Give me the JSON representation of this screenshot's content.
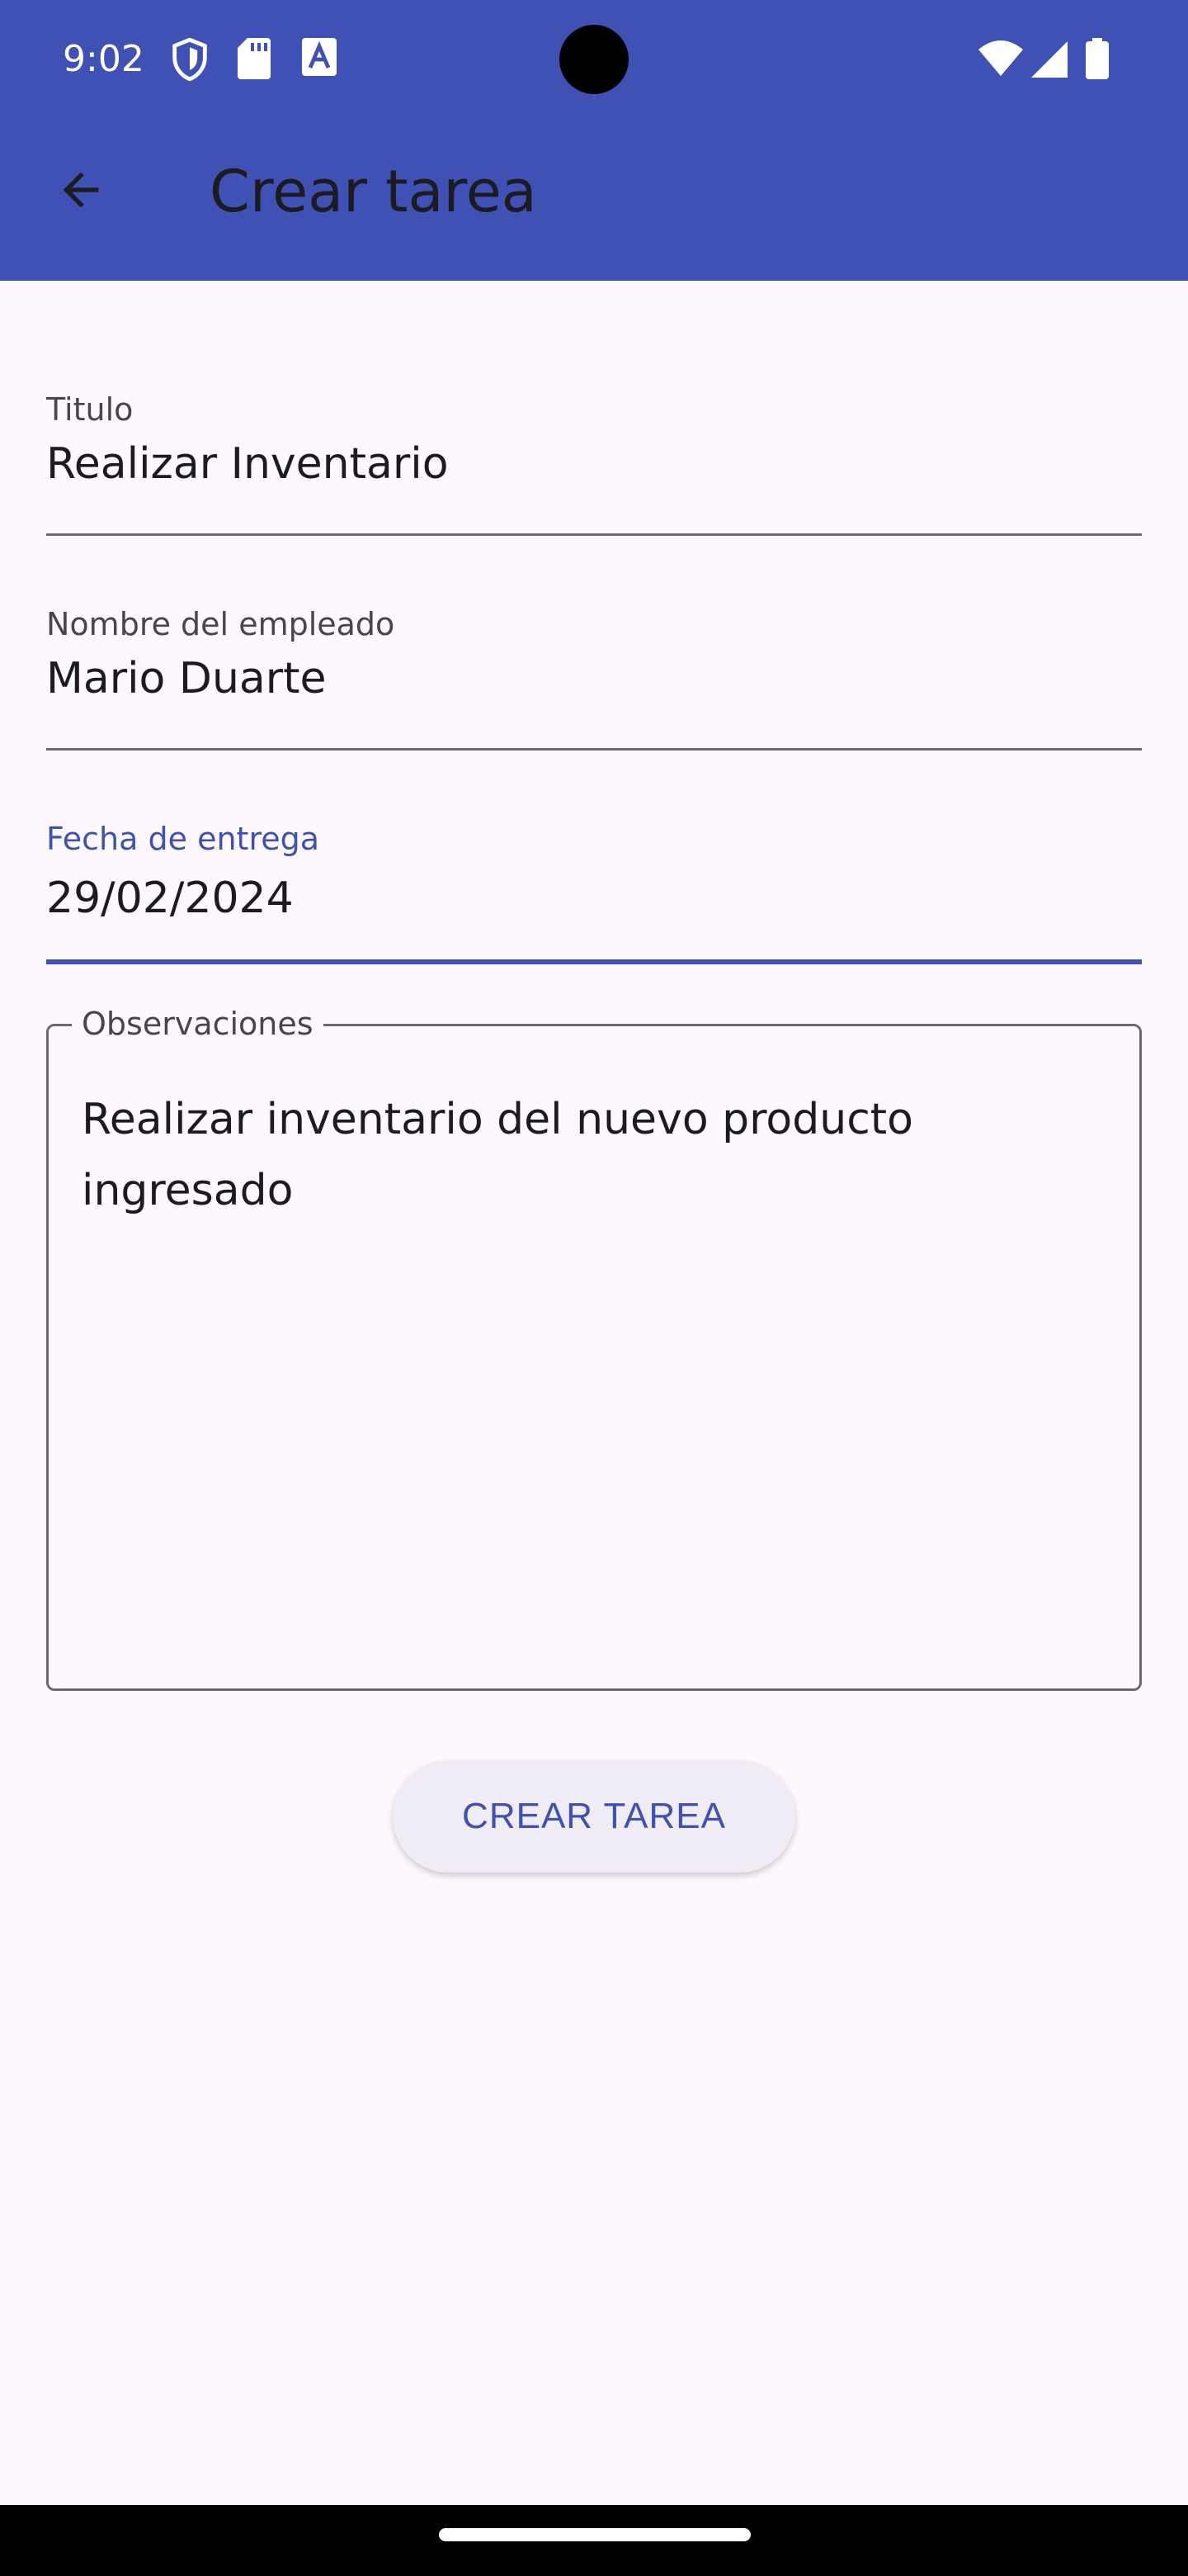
{
  "status_bar": {
    "time": "9:02",
    "left_icons": [
      "shield-icon",
      "sd-card-icon",
      "font-a-icon"
    ],
    "right_icons": [
      "wifi-icon",
      "signal-icon",
      "battery-icon"
    ]
  },
  "app_bar": {
    "title": "Crear tarea",
    "back_icon": "arrow-back-icon"
  },
  "form": {
    "title_field": {
      "label": "Titulo",
      "value": "Realizar Inventario"
    },
    "employee_field": {
      "label": "Nombre del empleado",
      "value": "Mario Duarte"
    },
    "date_field": {
      "label": "Fecha de entrega",
      "value": "29/02/2024"
    },
    "notes_field": {
      "label": "Observaciones",
      "value": "Realizar inventario del nuevo producto\ningresado"
    },
    "submit_label": "CREAR TAREA"
  },
  "colors": {
    "primary": "#3f51b5",
    "background": "#fdf8fd",
    "on_surface": "#1c1b1f",
    "button_surface": "#efecf6"
  }
}
